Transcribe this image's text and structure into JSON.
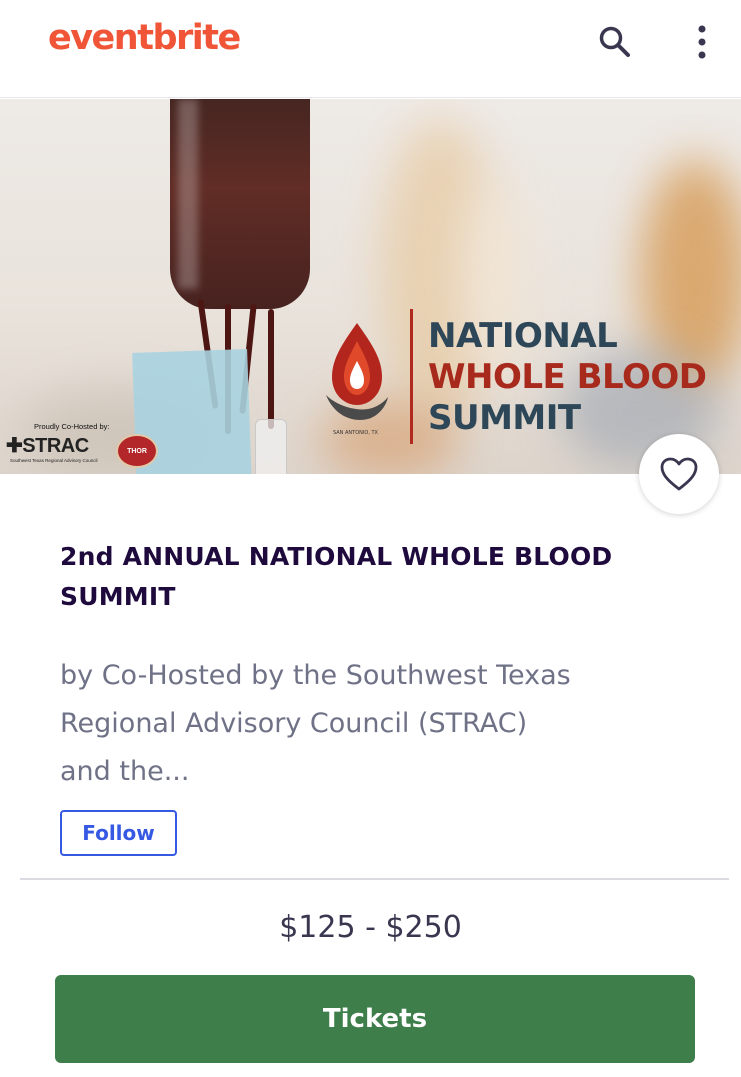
{
  "header": {
    "logo_text": "eventbrite",
    "search_icon": "search-icon",
    "more_icon": "more-vertical-icon"
  },
  "banner": {
    "summit_line1": "NATIONAL",
    "summit_line2": "WHOLE BLOOD",
    "summit_line3": "SUMMIT",
    "location": "SAN ANTONIO, TX",
    "cohost_label": "Proudly Co-Hosted by:",
    "strac_text": "STRAC",
    "strac_subtitle": "Southwest Texas Regional Advisory Council",
    "thor_text": "THOR"
  },
  "like_icon": "heart-outline-icon",
  "event": {
    "title": "2nd ANNUAL NATIONAL WHOLE BLOOD SUMMIT",
    "organizer": "by Co-Hosted by the Southwest Texas Regional Advisory Council (STRAC) and the...",
    "follow_label": "Follow"
  },
  "purchase": {
    "price": "$125 - $250",
    "tickets_label": "Tickets"
  },
  "colors": {
    "brand": "#f05537",
    "title": "#1e0a3c",
    "follow": "#3659e3",
    "tickets": "#3d7e4a"
  }
}
